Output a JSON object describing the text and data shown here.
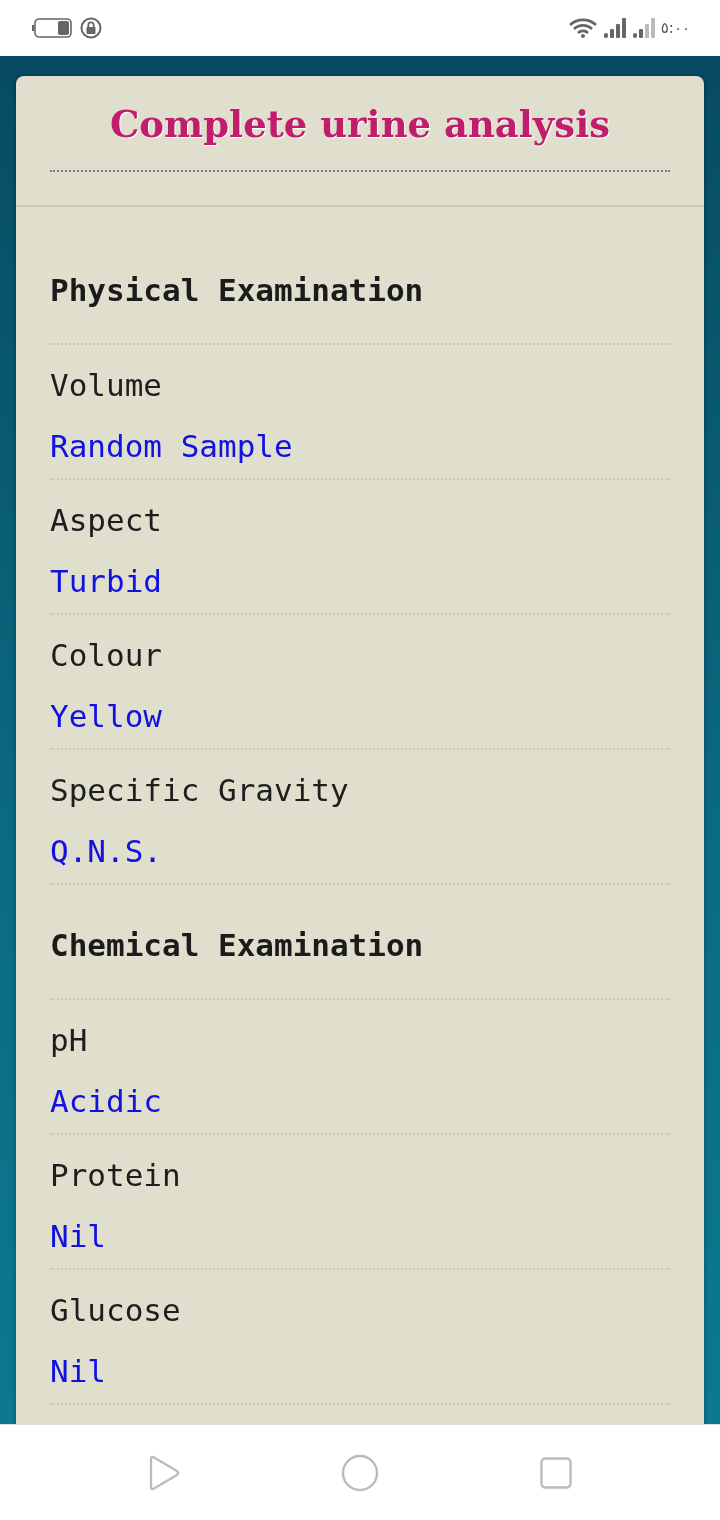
{
  "status_bar": {
    "time": "٥:٠٠"
  },
  "page": {
    "title": "Complete urine analysis"
  },
  "sections": [
    {
      "heading": "Physical Examination",
      "items": [
        {
          "label": "Volume",
          "value": "Random Sample"
        },
        {
          "label": "Aspect",
          "value": "Turbid"
        },
        {
          "label": "Colour",
          "value": "Yellow"
        },
        {
          "label": "Specific Gravity",
          "value": "Q.N.S."
        }
      ]
    },
    {
      "heading": "Chemical Examination",
      "items": [
        {
          "label": "pH",
          "value": "Acidic"
        },
        {
          "label": "Protein",
          "value": "Nil"
        },
        {
          "label": "Glucose",
          "value": "Nil"
        }
      ]
    }
  ]
}
